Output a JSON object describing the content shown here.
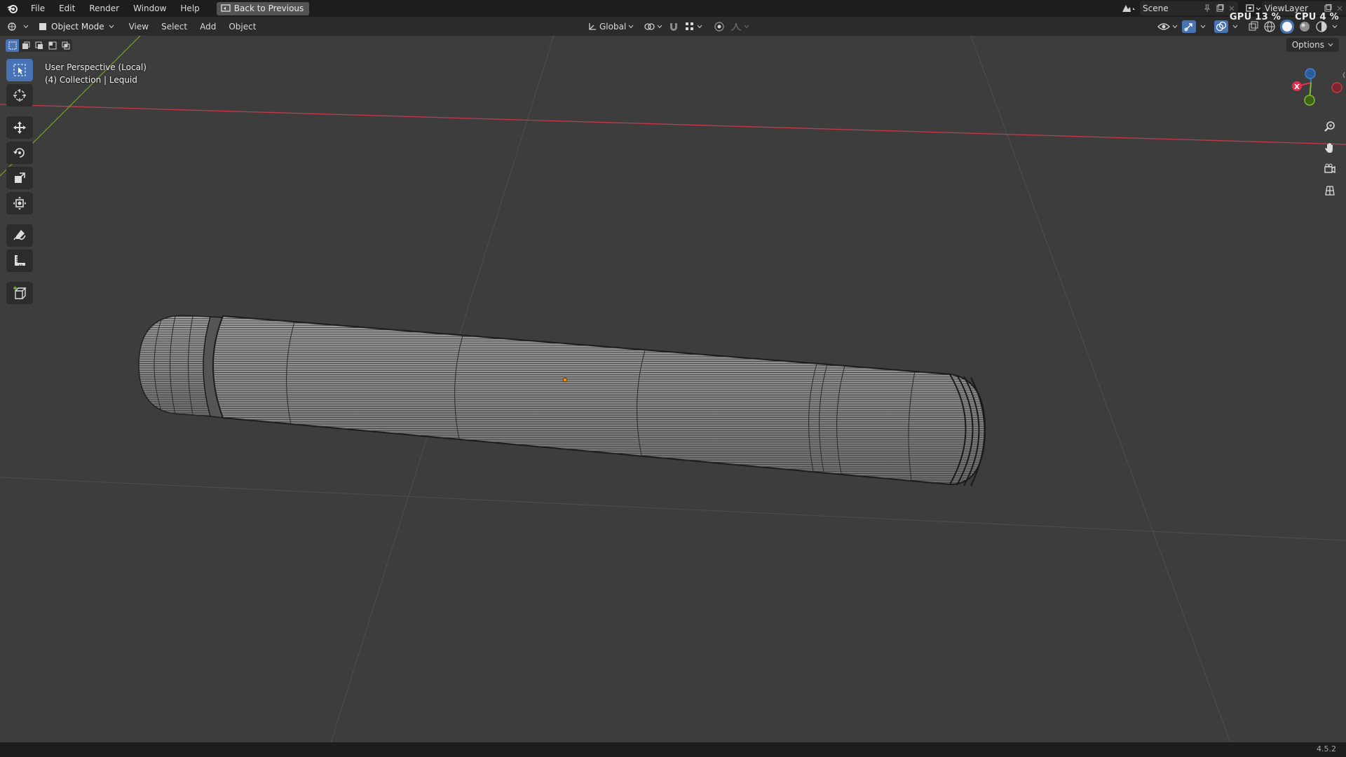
{
  "menubar": {
    "items": [
      "File",
      "Edit",
      "Render",
      "Window",
      "Help"
    ],
    "back_button": "Back to Previous",
    "scene_label": "Scene",
    "view_layer_label": "ViewLayer",
    "gpu": "GPU 13 %",
    "cpu": "CPU 4 %"
  },
  "header": {
    "mode": "Object Mode",
    "menus": [
      "View",
      "Select",
      "Add",
      "Object"
    ],
    "orientation": "Global",
    "options": "Options"
  },
  "viewport": {
    "perspective_label": "User Perspective (Local)",
    "collection_label": "(4) Collection | Lequid"
  },
  "status": {
    "version": "4.5.2"
  },
  "colors": {
    "accent": "#4772b3",
    "axis_x": "#e8304d",
    "axis_y": "#7ac02a",
    "axis_z": "#3b82d6",
    "origin": "#ff8f00"
  }
}
